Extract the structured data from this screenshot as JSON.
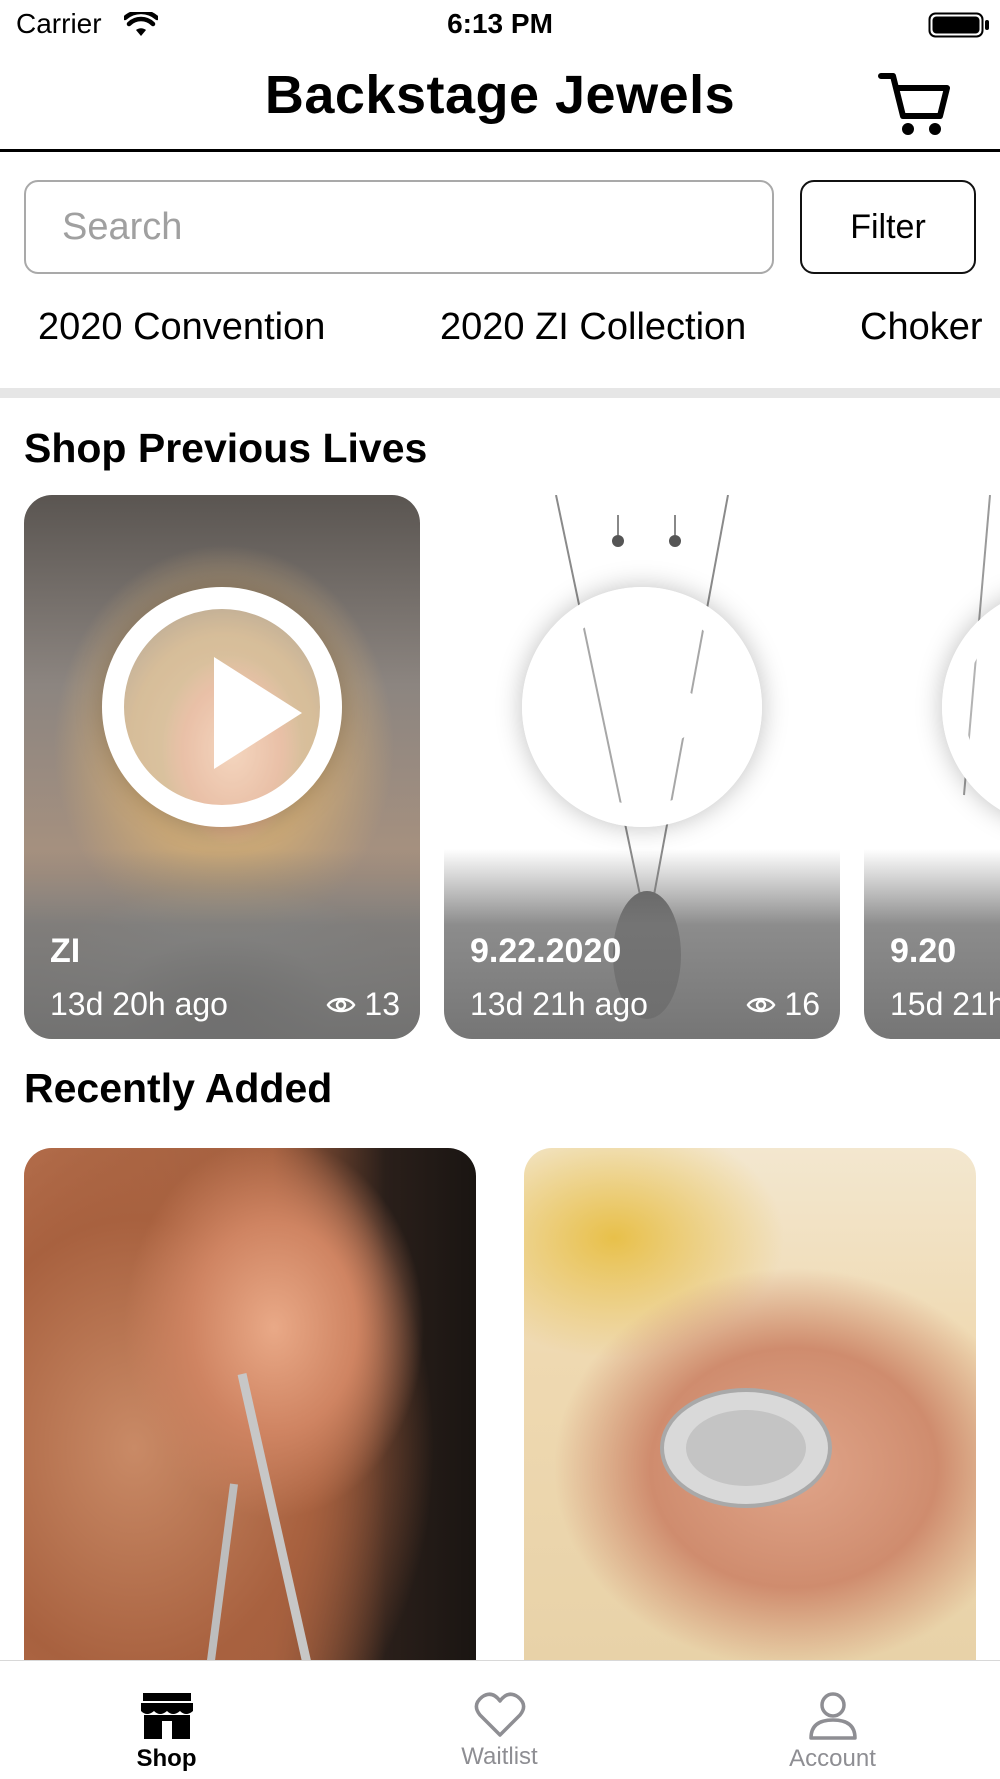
{
  "status_bar": {
    "carrier": "Carrier",
    "time": "6:13 PM"
  },
  "header": {
    "title": "Backstage Jewels"
  },
  "search": {
    "placeholder": "Search",
    "value": "",
    "filter_label": "Filter"
  },
  "categories": [
    "2020 Convention",
    "2020 ZI Collection",
    "Choker"
  ],
  "sections": {
    "previous_lives": "Shop Previous Lives",
    "recently_added": "Recently Added"
  },
  "lives": [
    {
      "name": "ZI",
      "time": "13d 20h ago",
      "views": "13"
    },
    {
      "name": "9.22.2020",
      "time": "13d 21h ago",
      "views": "16"
    },
    {
      "name": "9.20",
      "time": "15d 21h",
      "views": ""
    }
  ],
  "tabs": [
    {
      "label": "Shop",
      "icon": "store-icon",
      "active": true
    },
    {
      "label": "Waitlist",
      "icon": "heart-icon",
      "active": false
    },
    {
      "label": "Account",
      "icon": "person-icon",
      "active": false
    }
  ],
  "colors": {
    "accent": "#000000",
    "inactive": "#8e8e93",
    "divider": "#e6e6e6"
  }
}
